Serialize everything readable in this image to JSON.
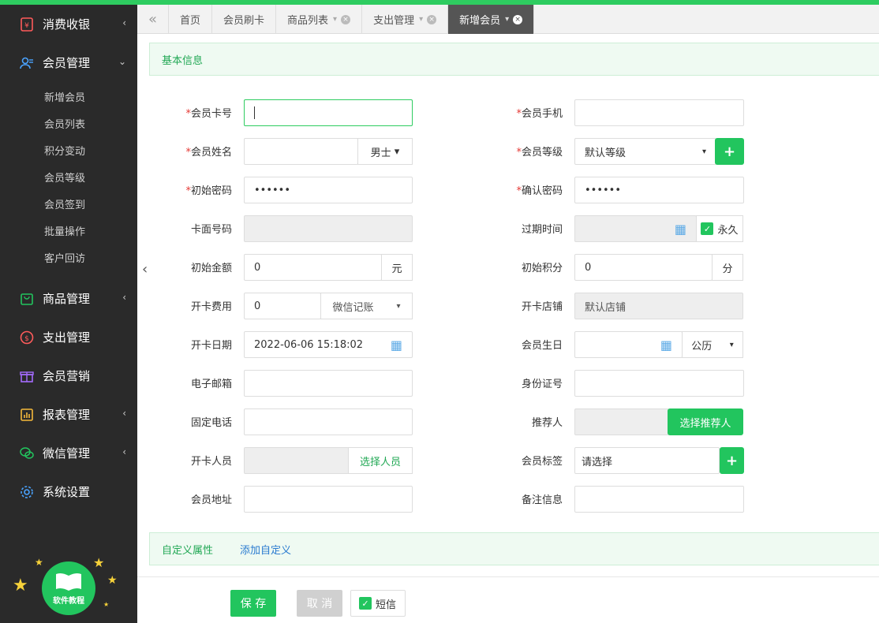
{
  "sidebar": {
    "items": [
      {
        "label": "消费收银",
        "icon": "cash-register-icon",
        "arrow": "‹"
      },
      {
        "label": "会员管理",
        "icon": "member-icon",
        "arrow": "⌄"
      },
      {
        "label": "商品管理",
        "icon": "goods-icon",
        "arrow": "‹"
      },
      {
        "label": "支出管理",
        "icon": "expense-icon",
        "arrow": ""
      },
      {
        "label": "会员营销",
        "icon": "gift-icon",
        "arrow": ""
      },
      {
        "label": "报表管理",
        "icon": "report-icon",
        "arrow": "‹"
      },
      {
        "label": "微信管理",
        "icon": "wechat-icon",
        "arrow": "‹"
      },
      {
        "label": "系统设置",
        "icon": "gear-icon",
        "arrow": ""
      }
    ],
    "submenu": [
      "新增会员",
      "会员列表",
      "积分变动",
      "会员等级",
      "会员签到",
      "批量操作",
      "客户回访"
    ],
    "tutorial_label": "软件教程"
  },
  "tabs": [
    {
      "label": "首页"
    },
    {
      "label": "会员刷卡"
    },
    {
      "label": "商品列表"
    },
    {
      "label": "支出管理"
    },
    {
      "label": "新增会员"
    }
  ],
  "section": {
    "basic_info": "基本信息",
    "custom_attrs": "自定义属性",
    "add_custom": "添加自定义"
  },
  "form": {
    "card_no": {
      "label": "会员卡号",
      "value": ""
    },
    "phone": {
      "label": "会员手机",
      "value": ""
    },
    "name": {
      "label": "会员姓名",
      "value": "",
      "gender": "男士"
    },
    "level": {
      "label": "会员等级",
      "value": "默认等级"
    },
    "init_pwd": {
      "label": "初始密码",
      "value": "••••••"
    },
    "confirm_pwd": {
      "label": "确认密码",
      "value": "••••••"
    },
    "face_no": {
      "label": "卡面号码",
      "value": ""
    },
    "expire": {
      "label": "过期时间",
      "value": "",
      "forever": "永久"
    },
    "init_amount": {
      "label": "初始金额",
      "value": "0",
      "unit": "元"
    },
    "init_points": {
      "label": "初始积分",
      "value": "0",
      "unit": "分"
    },
    "open_fee": {
      "label": "开卡费用",
      "value": "0",
      "pay": "微信记账"
    },
    "open_store": {
      "label": "开卡店铺",
      "value": "默认店铺"
    },
    "open_date": {
      "label": "开卡日期",
      "value": "2022-06-06 15:18:02"
    },
    "birthday": {
      "label": "会员生日",
      "value": "",
      "calendar": "公历"
    },
    "email": {
      "label": "电子邮箱",
      "value": ""
    },
    "id_card": {
      "label": "身份证号",
      "value": ""
    },
    "tel": {
      "label": "固定电话",
      "value": ""
    },
    "referrer": {
      "label": "推荐人",
      "value": "",
      "button": "选择推荐人"
    },
    "operator": {
      "label": "开卡人员",
      "value": "",
      "button": "选择人员"
    },
    "tags": {
      "label": "会员标签",
      "value": "请选择"
    },
    "address": {
      "label": "会员地址",
      "value": ""
    },
    "remark": {
      "label": "备注信息",
      "value": ""
    }
  },
  "footer": {
    "save": "保 存",
    "cancel": "取 消",
    "sms": "短信"
  },
  "colors": {
    "accent": "#22c55e",
    "sidebar_bg": "#2a2a2a",
    "required": "#e53935"
  }
}
